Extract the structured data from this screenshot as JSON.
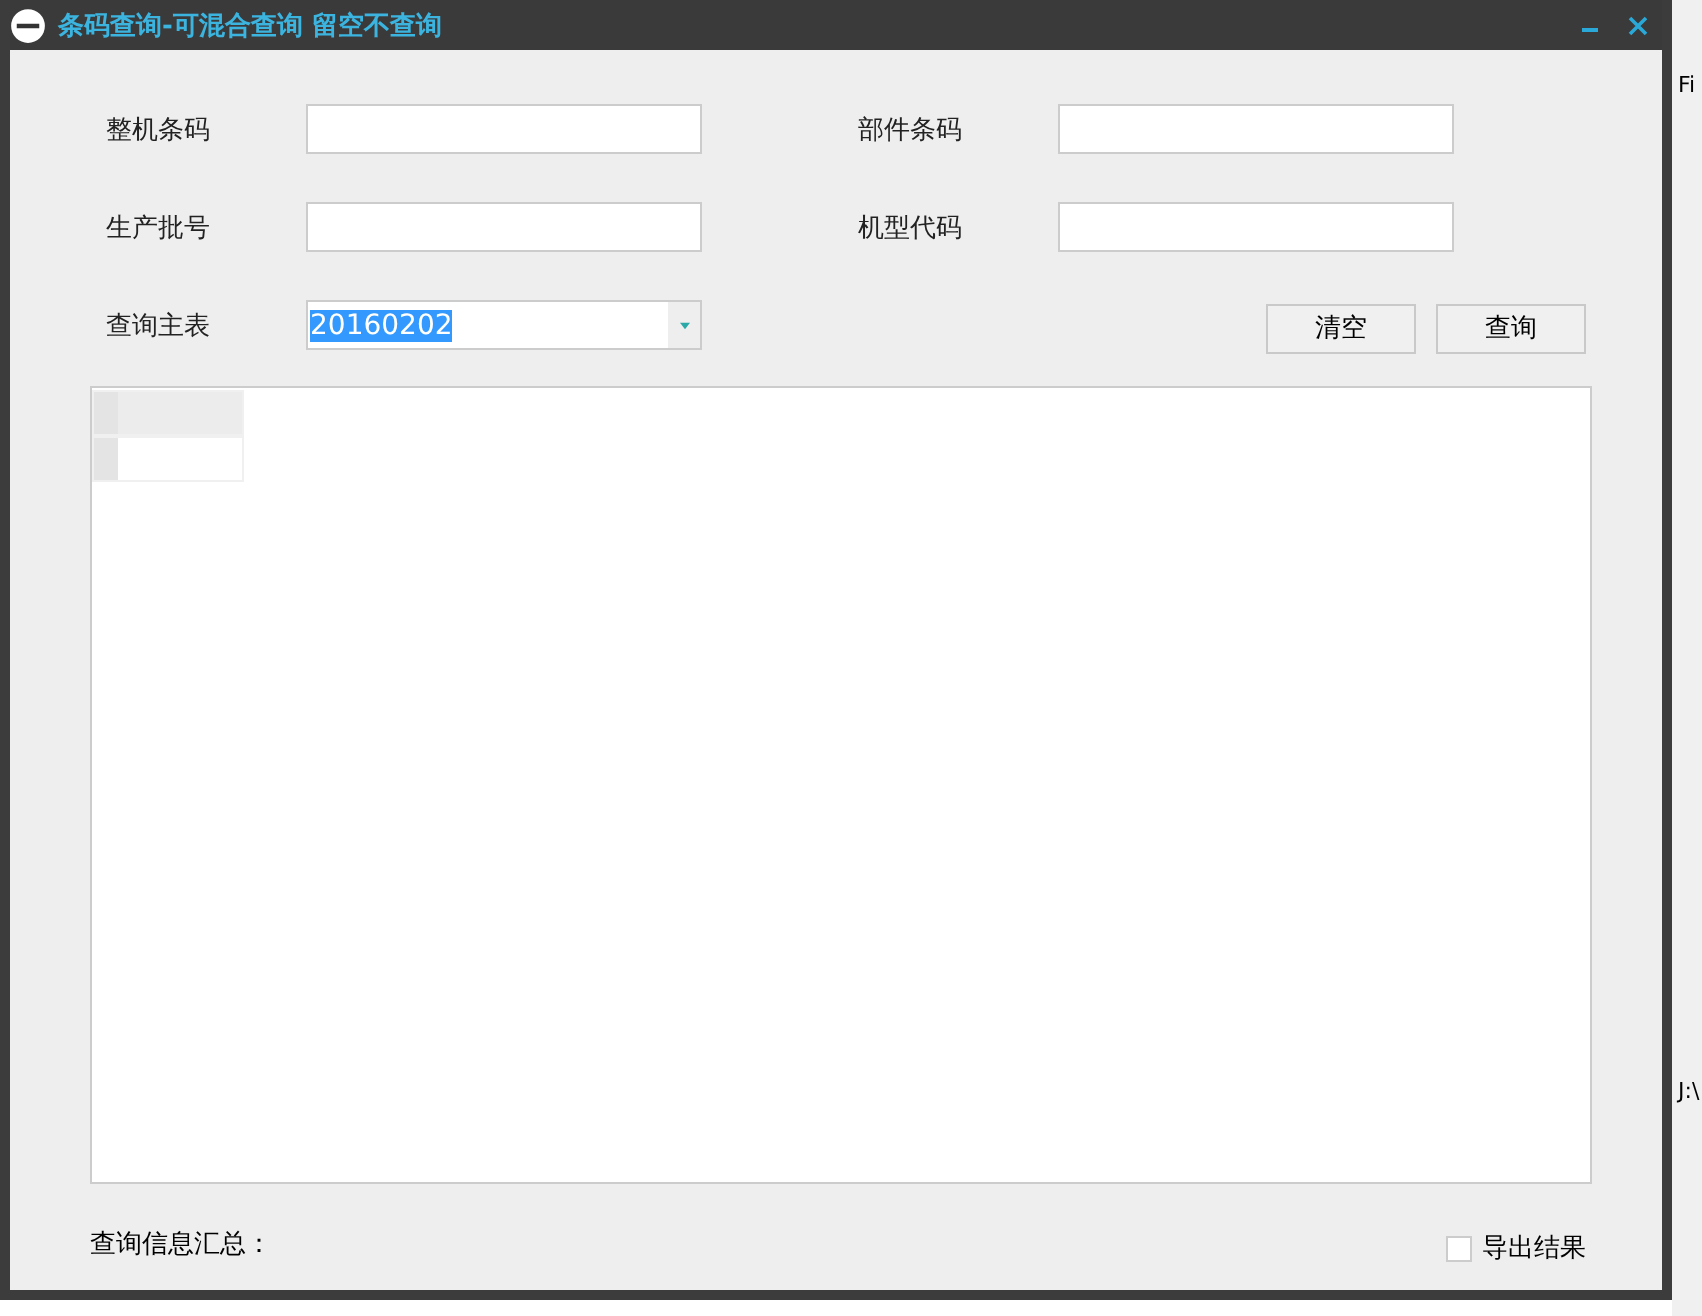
{
  "window": {
    "title": "条码查询-可混合查询 留空不查询"
  },
  "fields": [
    {
      "label": "整机条码"
    },
    {
      "label": "部件条码"
    },
    {
      "label": "生产批号"
    },
    {
      "label": "机型代码"
    }
  ],
  "main_table": {
    "label": "查询主表",
    "value": "20160202"
  },
  "buttons": [
    "清空",
    "查询"
  ],
  "summary_label": "查询信息汇总：",
  "export": {
    "label": "导出结果",
    "checked": false
  },
  "background": {
    "tab_text": "Fi",
    "path_text": "J:\\"
  }
}
